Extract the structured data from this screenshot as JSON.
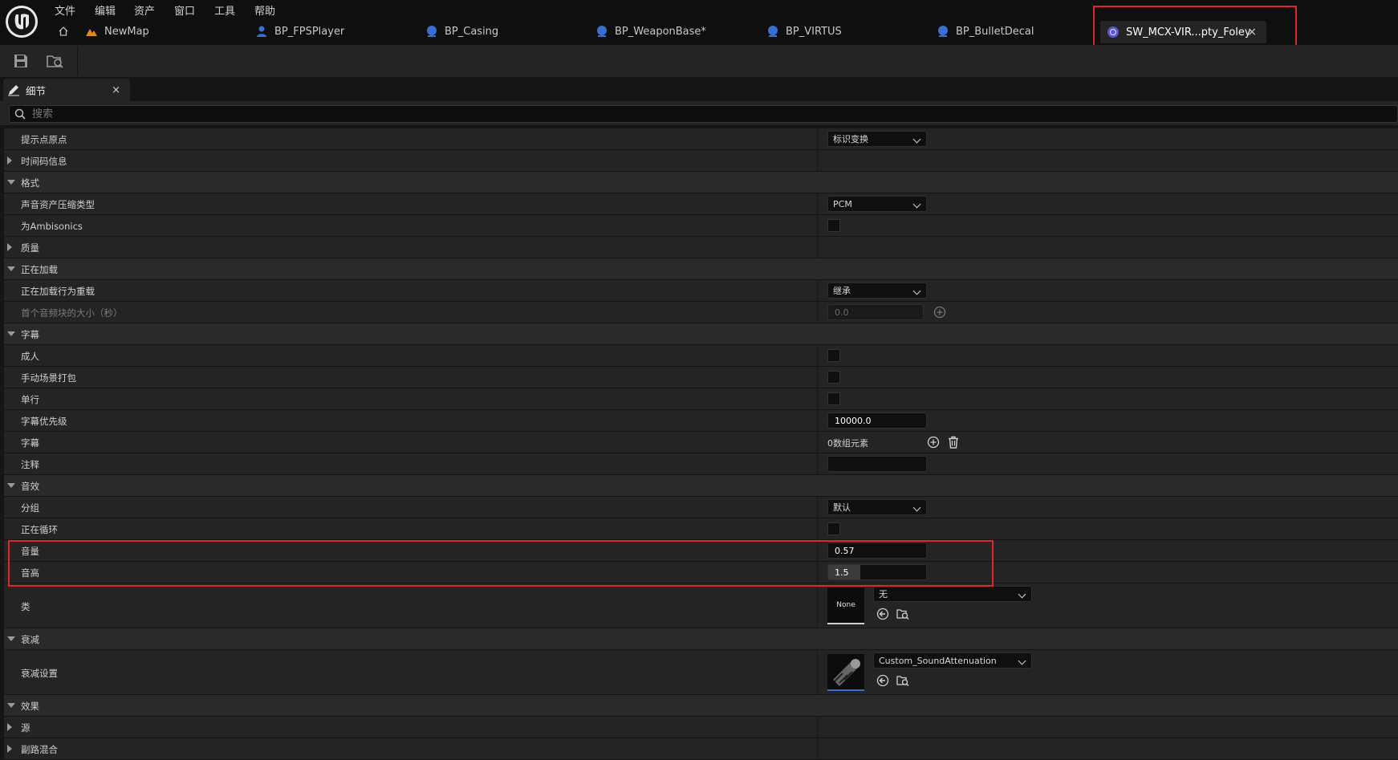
{
  "menu": [
    "文件",
    "编辑",
    "资产",
    "窗口",
    "工具",
    "帮助"
  ],
  "tabs": [
    {
      "label": "NewMap",
      "icon": "level-icon"
    },
    {
      "label": "BP_FPSPlayer",
      "icon": "blueprint-pawn-icon"
    },
    {
      "label": "BP_Casing",
      "icon": "blueprint-icon"
    },
    {
      "label": "BP_WeaponBase*",
      "icon": "blueprint-icon"
    },
    {
      "label": "BP_VIRTUS",
      "icon": "blueprint-icon"
    },
    {
      "label": "BP_BulletDecal",
      "icon": "blueprint-icon"
    }
  ],
  "active_tab": {
    "label": "SW_MCX-VIR...pty_Foley",
    "close": "×",
    "icon": "sound-wave-icon"
  },
  "toolbar": {
    "save_icon": "save-icon",
    "browse_icon": "browse-asset-icon"
  },
  "details_panel": {
    "tab_label": "细节",
    "close": "×",
    "search_placeholder": "搜索"
  },
  "rows": {
    "cue_point_origin": {
      "label": "提示点原点",
      "value": "标识变换"
    },
    "timecode_info": {
      "label": "时间码信息"
    },
    "format": {
      "label": "格式"
    },
    "compression_type": {
      "label": "声音资产压缩类型",
      "value": "PCM"
    },
    "is_ambisonics": {
      "label": "为Ambisonics",
      "checked": false
    },
    "quality": {
      "label": "质量"
    },
    "loading": {
      "label": "正在加载"
    },
    "loading_override": {
      "label": "正在加载行为重载",
      "value": "继承"
    },
    "first_chunk_size": {
      "label": "首个音频块的大小（秒）",
      "value": "0.0"
    },
    "subtitles": {
      "label": "字幕"
    },
    "mature": {
      "label": "成人",
      "checked": false
    },
    "manual_word_wrap": {
      "label": "手动场景打包",
      "checked": false
    },
    "single_line": {
      "label": "单行",
      "checked": false
    },
    "subtitle_priority": {
      "label": "字幕优先级",
      "value": "10000.0"
    },
    "subtitles_array": {
      "label": "字幕",
      "value": "0数组元素"
    },
    "comment": {
      "label": "注释",
      "value": ""
    },
    "sound": {
      "label": "音效"
    },
    "group": {
      "label": "分组",
      "value": "默认"
    },
    "looping": {
      "label": "正在循环",
      "checked": false
    },
    "volume": {
      "label": "音量",
      "value": "0.57"
    },
    "pitch": {
      "label": "音高",
      "value": "1.5",
      "fill_fraction": 0.33
    },
    "sound_class": {
      "label": "类",
      "thumb": "None",
      "value": "无"
    },
    "attenuation": {
      "label": "衰减"
    },
    "attenuation_settings": {
      "label": "衰减设置",
      "value": "Custom_SoundAttenuation"
    },
    "effects": {
      "label": "效果"
    },
    "source": {
      "label": "源"
    },
    "submix": {
      "label": "副路混合"
    }
  },
  "colors": {
    "highlight": "#e0262c",
    "bg": "#151515",
    "row": "#242424"
  }
}
